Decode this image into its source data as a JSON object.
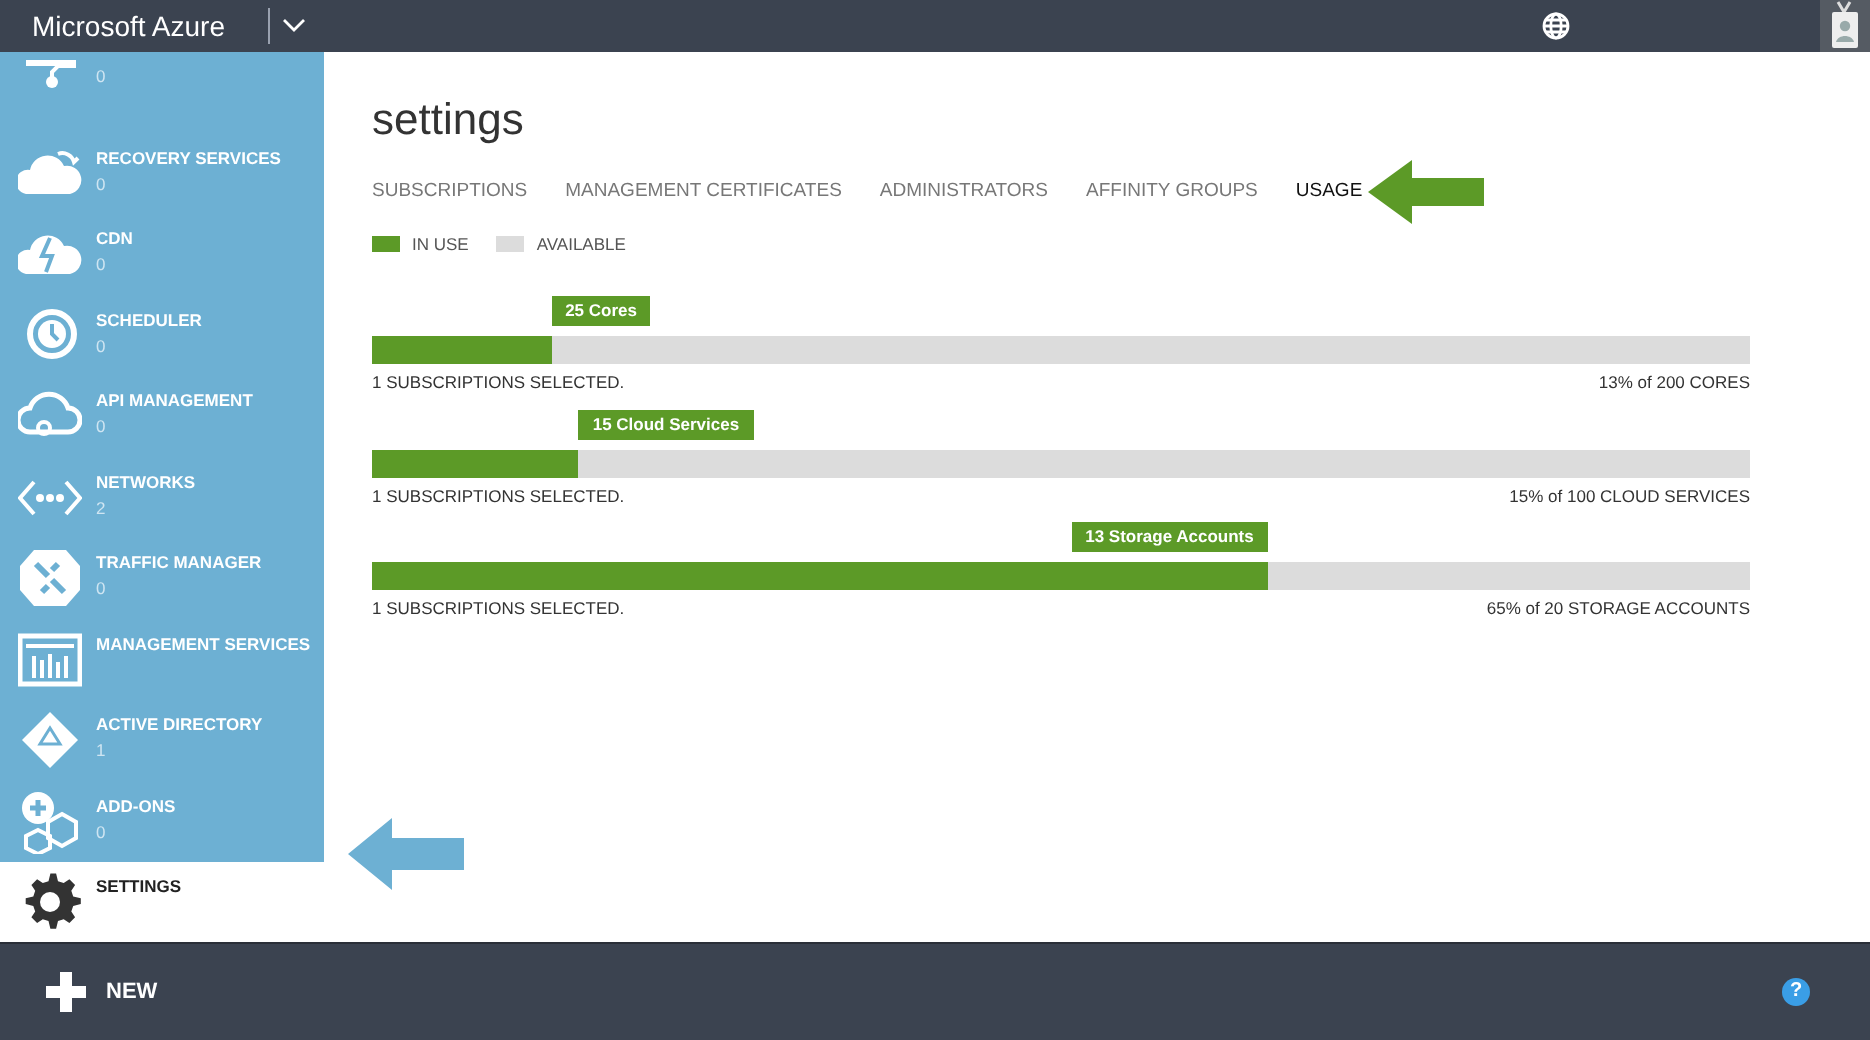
{
  "top_bar": {
    "brand": "Microsoft Azure"
  },
  "sidebar": {
    "items": [
      {
        "count": "0",
        "selected": false
      },
      {
        "label": "RECOVERY SERVICES",
        "count": "0",
        "selected": false
      },
      {
        "label": "CDN",
        "count": "0",
        "selected": false
      },
      {
        "label": "SCHEDULER",
        "count": "0",
        "selected": false
      },
      {
        "label": "API MANAGEMENT",
        "count": "0",
        "selected": false
      },
      {
        "label": "NETWORKS",
        "count": "2",
        "selected": false
      },
      {
        "label": "TRAFFIC MANAGER",
        "count": "0",
        "selected": false
      },
      {
        "label": "MANAGEMENT SERVICES",
        "selected": false
      },
      {
        "label": "ACTIVE DIRECTORY",
        "count": "1",
        "selected": false
      },
      {
        "label": "ADD-ONS",
        "count": "0",
        "selected": false
      },
      {
        "label": "SETTINGS",
        "selected": true
      }
    ]
  },
  "page": {
    "title": "settings",
    "tabs": [
      {
        "label": "SUBSCRIPTIONS",
        "selected": false
      },
      {
        "label": "MANAGEMENT CERTIFICATES",
        "selected": false
      },
      {
        "label": "ADMINISTRATORS",
        "selected": false
      },
      {
        "label": "AFFINITY GROUPS",
        "selected": false
      },
      {
        "label": "USAGE",
        "selected": true
      }
    ],
    "legend": [
      {
        "label": "IN USE",
        "color": "#5c9a27"
      },
      {
        "label": "AVAILABLE",
        "color": "#dcdcdc"
      }
    ],
    "meters": [
      {
        "callout": "25 Cores",
        "level": 0.13,
        "note": "1 SUBSCRIPTIONS SELECTED.",
        "reading": "13% of 200 CORES"
      },
      {
        "callout": "15 Cloud Services",
        "level": 0.15,
        "note": "1 SUBSCRIPTIONS SELECTED.",
        "reading": "15% of 100 CLOUD SERVICES"
      },
      {
        "callout": "13 Storage Accounts",
        "level": 0.65,
        "note": "1 SUBSCRIPTIONS SELECTED.",
        "reading": "65% of 20 STORAGE ACCOUNTS"
      }
    ]
  },
  "bottom_bar": {
    "new_label": "NEW",
    "help": "?"
  }
}
